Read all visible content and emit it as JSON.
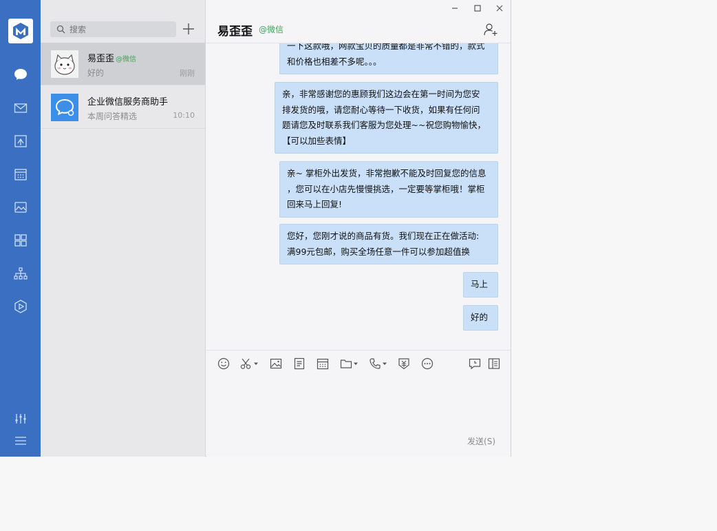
{
  "sidebar": {
    "nav": [
      {
        "icon": "chat-bubble-icon",
        "active": true
      },
      {
        "icon": "mail-icon"
      },
      {
        "icon": "shared-doc-icon"
      },
      {
        "icon": "calendar-icon"
      },
      {
        "icon": "photo-icon"
      },
      {
        "icon": "apps-grid-icon"
      },
      {
        "icon": "org-chart-icon"
      },
      {
        "icon": "hexagon-play-icon"
      }
    ],
    "bottom": [
      {
        "icon": "settings-sliders-icon"
      },
      {
        "icon": "menu-icon"
      }
    ],
    "accent": "#3a6fc2"
  },
  "search": {
    "placeholder": "搜索"
  },
  "conversations": [
    {
      "name": "易歪歪",
      "tag": "@微信",
      "preview": "好的",
      "time": "刚刚",
      "active": true
    },
    {
      "name": "企业微信服务商助手",
      "preview": "本周问答精选",
      "time": "10:10"
    }
  ],
  "chat": {
    "title": "易歪歪",
    "subtitle": "@微信",
    "messages": [
      {
        "lines": [
          "一下这款哦，网款宝贝的质量都是非常不错的，款式",
          "和价格也相差不多呢。。。"
        ]
      },
      {
        "lines": [
          "亲，非常感谢您的惠顾我们这边会在第一时间为您安",
          "排发货的哦，请您耐心等待一下收货，如果有任何问",
          "题请您及时联系我们客服为您处理~~祝您购物愉快，",
          "【可以加些表情】"
        ]
      },
      {
        "lines": [
          "亲~ 掌柜外出发货，非常抱歉不能及时回复您的信息",
          "，您可以在小店先慢慢挑选，一定要等掌柜哦！掌柜",
          "回来马上回复!"
        ]
      },
      {
        "lines": [
          "您好，您刚才说的商品有货。我们现在正在做活动:",
          "满99元包邮，购买全场任意一件可以参加超值换"
        ]
      },
      {
        "lines": [
          "马上"
        ]
      },
      {
        "lines": [
          "好的"
        ]
      }
    ],
    "send_label": "发送(S)"
  },
  "colors": {
    "bubble": "#c9e0f8",
    "tag_green": "#47a05a"
  }
}
